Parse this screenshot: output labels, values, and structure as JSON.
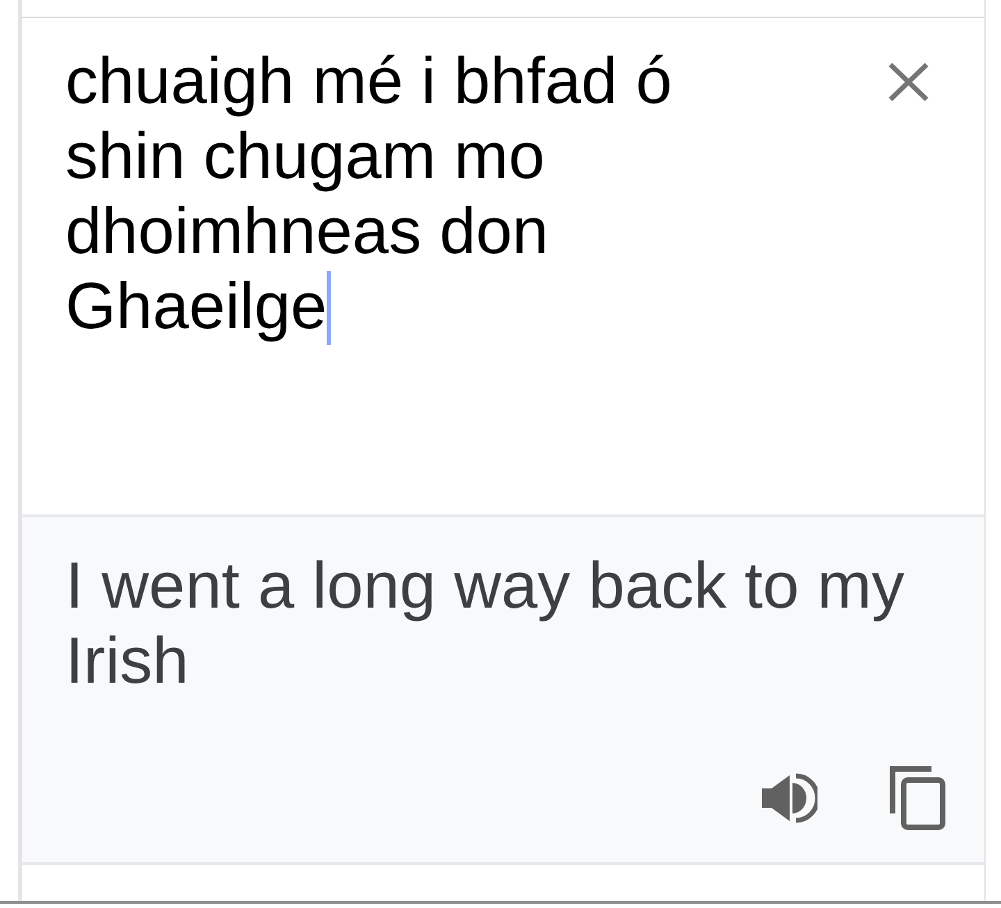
{
  "source": {
    "text": "chuaigh mé i bhfad ó shin chugam mo dhoimhneas don Ghaeilge",
    "focused": true
  },
  "translation": {
    "text": "I went a long way back to my Irish"
  }
}
